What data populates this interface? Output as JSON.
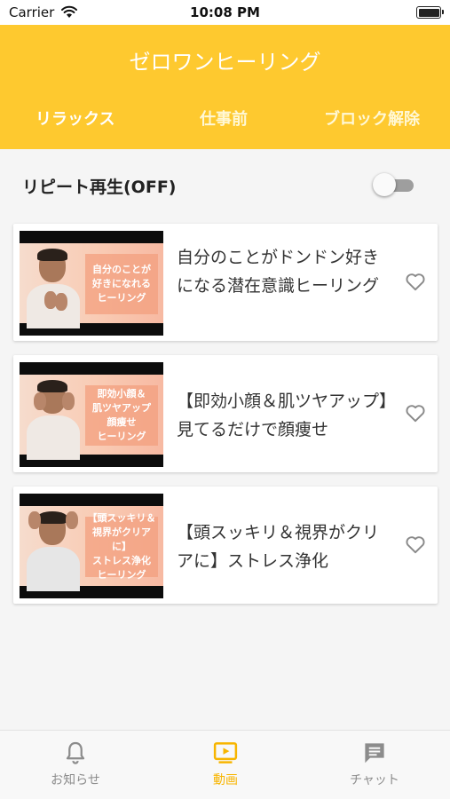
{
  "status_bar": {
    "carrier": "Carrier",
    "time": "10:08 PM"
  },
  "header": {
    "title": "ゼロワンヒーリング",
    "tabs": [
      {
        "label": "リラックス",
        "active": true
      },
      {
        "label": "仕事前",
        "active": false
      },
      {
        "label": "ブロック解除",
        "active": false
      }
    ]
  },
  "repeat": {
    "label": "リピート再生(OFF)",
    "on": false
  },
  "videos": [
    {
      "title": "自分のことがドンドン好きになる潜在意識ヒーリング",
      "thumb_caption": "自分のことが\n好きになれる\nヒーリング",
      "favorite": false
    },
    {
      "title": "【即効小顔＆肌ツヤアップ】見てるだけで顔痩せ",
      "thumb_caption": "即効小顔＆\n肌ツヤアップ\n顔痩せ\nヒーリング",
      "favorite": false
    },
    {
      "title": "【頭スッキリ＆視界がクリアに】ストレス浄化",
      "thumb_caption": "【頭スッキリ＆\n視界がクリアに】\nストレス浄化\nヒーリング",
      "favorite": false
    }
  ],
  "bottom_nav": [
    {
      "label": "お知らせ",
      "icon": "bell-icon",
      "active": false
    },
    {
      "label": "動画",
      "icon": "video-play-icon",
      "active": true
    },
    {
      "label": "チャット",
      "icon": "chat-icon",
      "active": false
    }
  ],
  "colors": {
    "primary": "#fec92f",
    "active_nav": "#f7b500",
    "inactive_nav": "#8c8c8c"
  }
}
